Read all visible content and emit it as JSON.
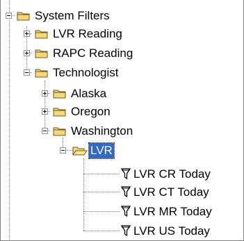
{
  "tree": {
    "root": {
      "label": "System Filters",
      "icon": "folder-icon",
      "expanded": true,
      "children": [
        {
          "label": "LVR Reading",
          "icon": "folder-icon",
          "expanded": false
        },
        {
          "label": "RAPC Reading",
          "icon": "folder-icon",
          "expanded": false
        },
        {
          "label": "Technologist",
          "icon": "folder-icon",
          "expanded": true,
          "children": [
            {
              "label": "Alaska",
              "icon": "folder-icon",
              "expanded": false
            },
            {
              "label": "Oregon",
              "icon": "folder-icon",
              "expanded": false
            },
            {
              "label": "Washington",
              "icon": "folder-icon",
              "expanded": true,
              "children": [
                {
                  "label": "LVR",
                  "icon": "open-folder-icon",
                  "expanded": true,
                  "selected": true,
                  "children": [
                    {
                      "label": "LVR CR Today",
                      "icon": "filter-icon"
                    },
                    {
                      "label": "LVR CT Today",
                      "icon": "filter-icon"
                    },
                    {
                      "label": "LVR MR Today",
                      "icon": "filter-icon"
                    },
                    {
                      "label": "LVR US Today",
                      "icon": "filter-icon"
                    }
                  ]
                }
              ]
            }
          ]
        }
      ]
    }
  },
  "colors": {
    "selection_bg": "#316ac5",
    "selection_text": "#ffffff",
    "folder_fill": "#f7d774",
    "folder_stroke": "#6b5a1e",
    "connector_line": "#808080",
    "background": "#ffffff"
  }
}
